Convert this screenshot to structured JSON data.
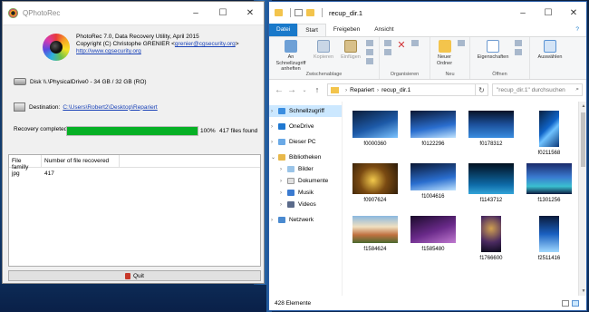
{
  "qphotorec": {
    "title": "QPhotoRec",
    "about": {
      "line1": "PhotoRec 7.0, Data Recovery Utility, April 2015",
      "line2_prefix": "Copyright (C) Christophe GRENIER <",
      "line2_email": "grenier@cgsecurity.org",
      "line2_suffix": ">",
      "url": "http://www.cgsecurity.org"
    },
    "disk": "Disk \\\\.\\PhysicalDrive0 - 34 GB / 32 GB (RO)",
    "destination_label": "Destination:",
    "destination_path": "C:\\Users\\Robert2\\Desktop\\Repariert",
    "progress": {
      "label": "Recovery completed",
      "value": 100,
      "percent_text": "100%",
      "files_text": "417 files found",
      "color": "#06b025"
    },
    "table": {
      "headers": [
        "File familly",
        "Number of file recovered"
      ],
      "rows": [
        [
          "jpg",
          "417"
        ]
      ]
    },
    "quit_label": "Quit"
  },
  "explorer": {
    "title": "recup_dir.1",
    "tabs": {
      "file": "Datei",
      "start": "Start",
      "share": "Freigeben",
      "view": "Ansicht"
    },
    "ribbon": {
      "pin": "An Schnellzugriff anheften",
      "copy": "Kopieren",
      "paste": "Einfügen",
      "group_clipboard": "Zwischenablage",
      "group_organize": "Organisieren",
      "new_folder": "Neuer Ordner",
      "group_new": "Neu",
      "properties": "Eigenschaften",
      "group_open": "Öffnen",
      "select": "Auswählen"
    },
    "address": {
      "parent": "Repariert",
      "current": "recup_dir.1"
    },
    "search_placeholder": "\"recup_dir.1\" durchsuchen",
    "nav": {
      "quick": "Schnellzugriff",
      "onedrive": "OneDrive",
      "thispc": "Dieser PC",
      "libraries": "Bibliotheken",
      "pictures": "Bilder",
      "documents": "Dokumente",
      "music": "Musik",
      "videos": "Videos",
      "network": "Netzwerk"
    },
    "files": [
      {
        "name": "f0000360",
        "art": "t-blue1",
        "shape": "wide"
      },
      {
        "name": "f0122296",
        "art": "t-blue2",
        "shape": "wide"
      },
      {
        "name": "f0178312",
        "art": "t-blue3",
        "shape": "wide"
      },
      {
        "name": "f0211568",
        "art": "t-win",
        "shape": "tall"
      },
      {
        "name": "f0907624",
        "art": "t-game",
        "shape": "mid"
      },
      {
        "name": "f1004616",
        "art": "t-blue2",
        "shape": "wide"
      },
      {
        "name": "f1143712",
        "art": "t-sea",
        "shape": "mid"
      },
      {
        "name": "f1301256",
        "art": "t-stage",
        "shape": "mid"
      },
      {
        "name": "f1584624",
        "art": "t-crowd",
        "shape": "wide"
      },
      {
        "name": "f1585480",
        "art": "t-purple",
        "shape": "wide"
      },
      {
        "name": "f1766600",
        "art": "t-nebula",
        "shape": "tall"
      },
      {
        "name": "f2511416",
        "art": "t-glow",
        "shape": "tall"
      }
    ],
    "status": "428 Elemente"
  }
}
